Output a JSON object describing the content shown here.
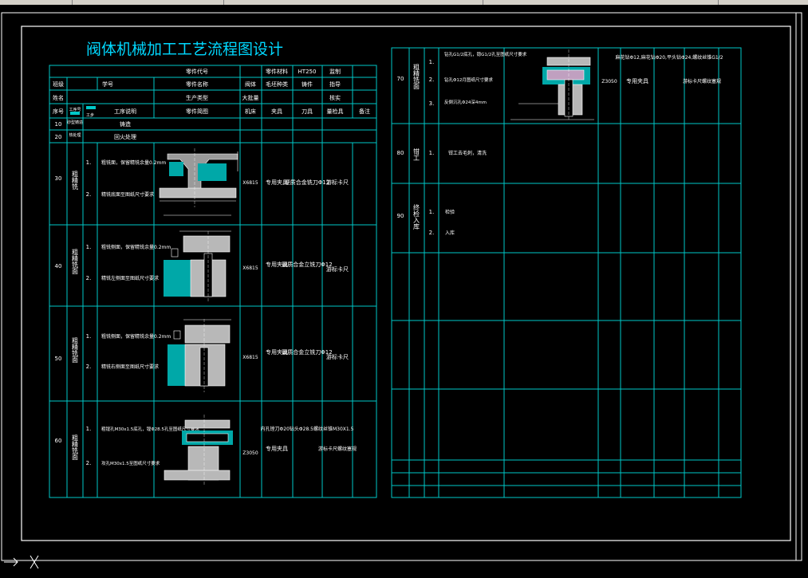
{
  "window": {
    "toolbar_fields": [
      "",
      "",
      "",
      ""
    ]
  },
  "drawing": {
    "title": "阀体机械加工工艺流程图设计",
    "colors": {
      "background": "#000000",
      "frame": "#ffffff",
      "grid": "#00c8c8",
      "text": "#ffffff",
      "title": "#00d8ff",
      "hatch": "#00b0b0",
      "part": "#b8b8b8",
      "dim": "#ffffff"
    },
    "header": {
      "r1": {
        "part_code": "零件代号",
        "material_label": "零件材料",
        "material": "HT250",
        "c4": "监制"
      },
      "r2": {
        "c1": "班级",
        "c2": "学号",
        "part_name_label": "零件名称",
        "c4": "阀体",
        "c5": "毛坯种类",
        "c6": "铸件",
        "c7": "指导"
      },
      "r3": {
        "c1": "姓名",
        "prod_type_label": "生产类型",
        "prod_type": "大批量",
        "c4": "核实"
      },
      "r4": {
        "seq": "序号",
        "proc_no": "工序号",
        "step_no": "工步",
        "step_desc": "工序说明",
        "diagram": "零件简图",
        "machine": "机床",
        "fixture": "夹具",
        "tool": "刀具",
        "gauge": "量检具",
        "note": "备注"
      }
    },
    "left_rows": [
      {
        "no": "10",
        "proc": "砂型铸造",
        "desc": "铸造"
      },
      {
        "no": "20",
        "proc": "热处理",
        "desc": "回火处理"
      },
      {
        "no": "30",
        "proc": "粗精铣",
        "steps": [
          {
            "n": "1.",
            "t": "粗铣面，保留精铣余量0.2mm"
          },
          {
            "n": "2.",
            "t": "精铣底面至图纸尺寸要求"
          }
        ],
        "machine": "X6815",
        "fixture": "专用夹具",
        "tool": "硬质合金铣刀Φ12",
        "gauge": "游标卡尺"
      },
      {
        "no": "40",
        "proc": "粗精铣面",
        "steps": [
          {
            "n": "1.",
            "t": "粗铣侧面，保留精铣余量0.2mm"
          },
          {
            "n": "2.",
            "t": "精铣左侧面至图纸尺寸要求"
          }
        ],
        "machine": "X6815",
        "fixture": "专用夹具",
        "tool": "硬质合金立铣刀Φ12",
        "gauge": "游标卡尺"
      },
      {
        "no": "50",
        "proc": "粗精铣面",
        "steps": [
          {
            "n": "1.",
            "t": "粗铣侧面，保留精铣余量0.2mm"
          },
          {
            "n": "2.",
            "t": "精铣右侧面至图纸尺寸要求"
          }
        ],
        "machine": "X6815",
        "fixture": "专用夹具",
        "tool": "硬质合金立铣刀Φ12",
        "gauge": "游标卡尺"
      },
      {
        "no": "60",
        "proc": "粗精铣面",
        "steps": [
          {
            "n": "1.",
            "t": "粗镗孔M30x1.5底孔，镗Φ28.5孔至图纸尺寸要求"
          },
          {
            "n": "2.",
            "t": "攻孔M30x1.5至图纸尺寸要求"
          }
        ],
        "machine": "Z3050",
        "fixture": "专用夹具",
        "tool": "内孔镗刀Φ20钻头Φ28.5螺纹丝锥M30X1.5",
        "gauge": "游标卡尺螺纹塞规"
      }
    ],
    "right_rows": [
      {
        "no": "70",
        "proc": "粗精铣面",
        "steps": [
          {
            "n": "1.",
            "t": "钻孔G1/2底孔，锪G1/2孔至图纸尺寸要求"
          },
          {
            "n": "2.",
            "t": "钻孔Φ12月图纸尺寸要求"
          },
          {
            "n": "3.",
            "t": "反倒沉孔Φ24深4mm"
          }
        ],
        "machine": "Z3050",
        "fixture": "专用夹具",
        "tool": "麻花钻Φ12,麻花钻Φ20,平头钻Φ24,螺纹丝锥G1/2",
        "gauge": "游标卡尺螺纹塞规"
      },
      {
        "no": "80",
        "proc": "钳工",
        "steps": [
          {
            "n": "1.",
            "t": "钳工去毛刺，清洗"
          }
        ]
      },
      {
        "no": "90",
        "proc": "终检入库",
        "steps": [
          {
            "n": "1.",
            "t": "检验"
          },
          {
            "n": "2.",
            "t": "入库"
          }
        ]
      }
    ]
  }
}
